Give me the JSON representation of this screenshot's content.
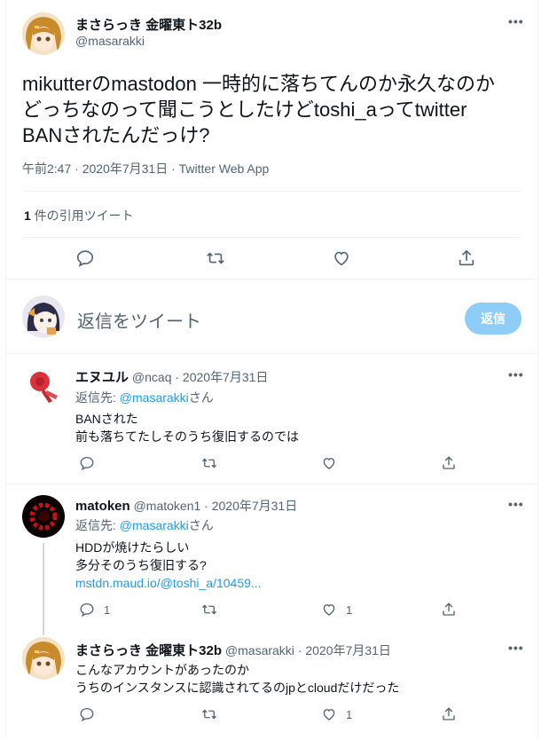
{
  "main": {
    "name": "まさらっき 金曜東ト32b",
    "handle": "@masarakki",
    "text_line1": "mikutterのmastodon 一時的に落ちてんのか永久なのか",
    "text_line2": "どっちなのって聞こうとしたけどtoshi_aってtwitter",
    "text_line3": "BANされたんだっけ?",
    "meta": "午前2:47 · 2020年7月31日 · Twitter Web App",
    "quote_count": "1",
    "quote_label": " 件の引用ツイート"
  },
  "compose": {
    "placeholder": "返信をツイート",
    "button": "返信"
  },
  "replies": [
    {
      "name": "エヌユル",
      "handle_time": "@ncaq · 2020年7月31日",
      "reply_prefix": "返信先: ",
      "reply_to": "@masarakki",
      "reply_suffix": "さん",
      "line1": "BANされた",
      "line2": "前も落ちてたしそのうち復旧するのでは",
      "reply_count": "",
      "like_count": ""
    },
    {
      "name": "matoken",
      "handle_time": "@matoken1 · 2020年7月31日",
      "reply_prefix": "返信先: ",
      "reply_to": "@masarakki",
      "reply_suffix": "さん",
      "line1": "HDDが焼けたらしい",
      "line2": "多分そのうち復旧する?",
      "link": "mstdn.maud.io/@toshi_a/10459...",
      "reply_count": "1",
      "like_count": "1"
    },
    {
      "name": "まさらっき 金曜東ト32b",
      "handle_time": "@masarakki · 2020年7月31日",
      "line1": "こんなアカウントがあったのか",
      "line2": "うちのインスタンスに認識されてるのjpとcloudだけだった",
      "reply_count": "",
      "like_count": "1"
    }
  ],
  "icons": {
    "more": "more-icon",
    "reply": "reply-icon",
    "retweet": "retweet-icon",
    "like": "heart-icon",
    "share": "share-icon"
  },
  "colors": {
    "accent": "#1d9bf0",
    "button_disabled": "#8ecdf8",
    "secondary_text": "#536471"
  }
}
